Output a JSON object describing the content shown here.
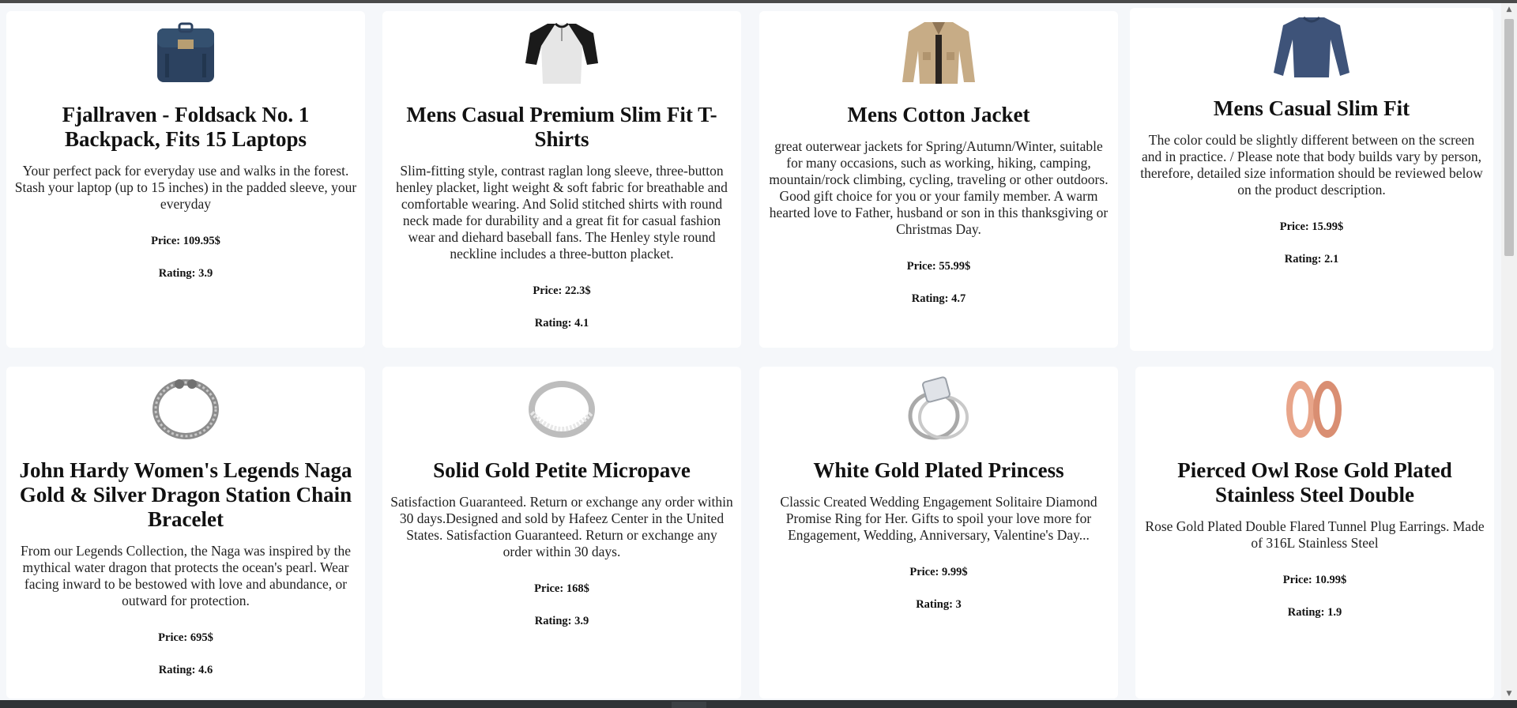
{
  "products": [
    {
      "title": "Fjallraven - Foldsack No. 1 Backpack, Fits 15 Laptops",
      "description": "Your perfect pack for everyday use and walks in the forest. Stash your laptop (up to 15 inches) in the padded sleeve, your everyday",
      "price": "Price: 109.95$",
      "rating": "Rating: 3.9",
      "image": "backpack-image"
    },
    {
      "title": "Mens Casual Premium Slim Fit T-Shirts",
      "description": "Slim-fitting style, contrast raglan long sleeve, three-button henley placket, light weight & soft fabric for breathable and comfortable wearing. And Solid stitched shirts with round neck made for durability and a great fit for casual fashion wear and diehard baseball fans. The Henley style round neckline includes a three-button placket.",
      "price": "Price: 22.3$",
      "rating": "Rating: 4.1",
      "image": "raglan-tshirt-image"
    },
    {
      "title": "Mens Cotton Jacket",
      "description": "great outerwear jackets for Spring/Autumn/Winter, suitable for many occasions, such as working, hiking, camping, mountain/rock climbing, cycling, traveling or other outdoors. Good gift choice for you or your family member. A warm hearted love to Father, husband or son in this thanksgiving or Christmas Day.",
      "price": "Price: 55.99$",
      "rating": "Rating: 4.7",
      "image": "cotton-jacket-image"
    },
    {
      "title": "Mens Casual Slim Fit",
      "description": "The color could be slightly different between on the screen and in practice. / Please note that body builds vary by person, therefore, detailed size information should be reviewed below on the product description.",
      "price": "Price: 15.99$",
      "rating": "Rating: 2.1",
      "image": "long-sleeve-shirt-image"
    },
    {
      "title": "John Hardy Women's Legends Naga Gold & Silver Dragon Station Chain Bracelet",
      "description": "From our Legends Collection, the Naga was inspired by the mythical water dragon that protects the ocean's pearl. Wear facing inward to be bestowed with love and abundance, or outward for protection.",
      "price": "Price: 695$",
      "rating": "Rating: 4.6",
      "image": "chain-bracelet-image"
    },
    {
      "title": "Solid Gold Petite Micropave",
      "description": "Satisfaction Guaranteed. Return or exchange any order within 30 days.Designed and sold by Hafeez Center in the United States. Satisfaction Guaranteed. Return or exchange any order within 30 days.",
      "price": "Price: 168$",
      "rating": "Rating: 3.9",
      "image": "micropave-ring-image"
    },
    {
      "title": "White Gold Plated Princess",
      "description": "Classic Created Wedding Engagement Solitaire Diamond Promise Ring for Her. Gifts to spoil your love more for Engagement, Wedding, Anniversary, Valentine's Day...",
      "price": "Price: 9.99$",
      "rating": "Rating: 3",
      "image": "princess-ring-image"
    },
    {
      "title": "Pierced Owl Rose Gold Plated Stainless Steel Double",
      "description": "Rose Gold Plated Double Flared Tunnel Plug Earrings. Made of 316L Stainless Steel",
      "price": "Price: 10.99$",
      "rating": "Rating: 1.9",
      "image": "tunnel-earrings-image"
    }
  ],
  "colors": {
    "page_background": "#f5f7fa",
    "card_background": "#ffffff",
    "scroll_thumb": "#c1c1c1"
  }
}
